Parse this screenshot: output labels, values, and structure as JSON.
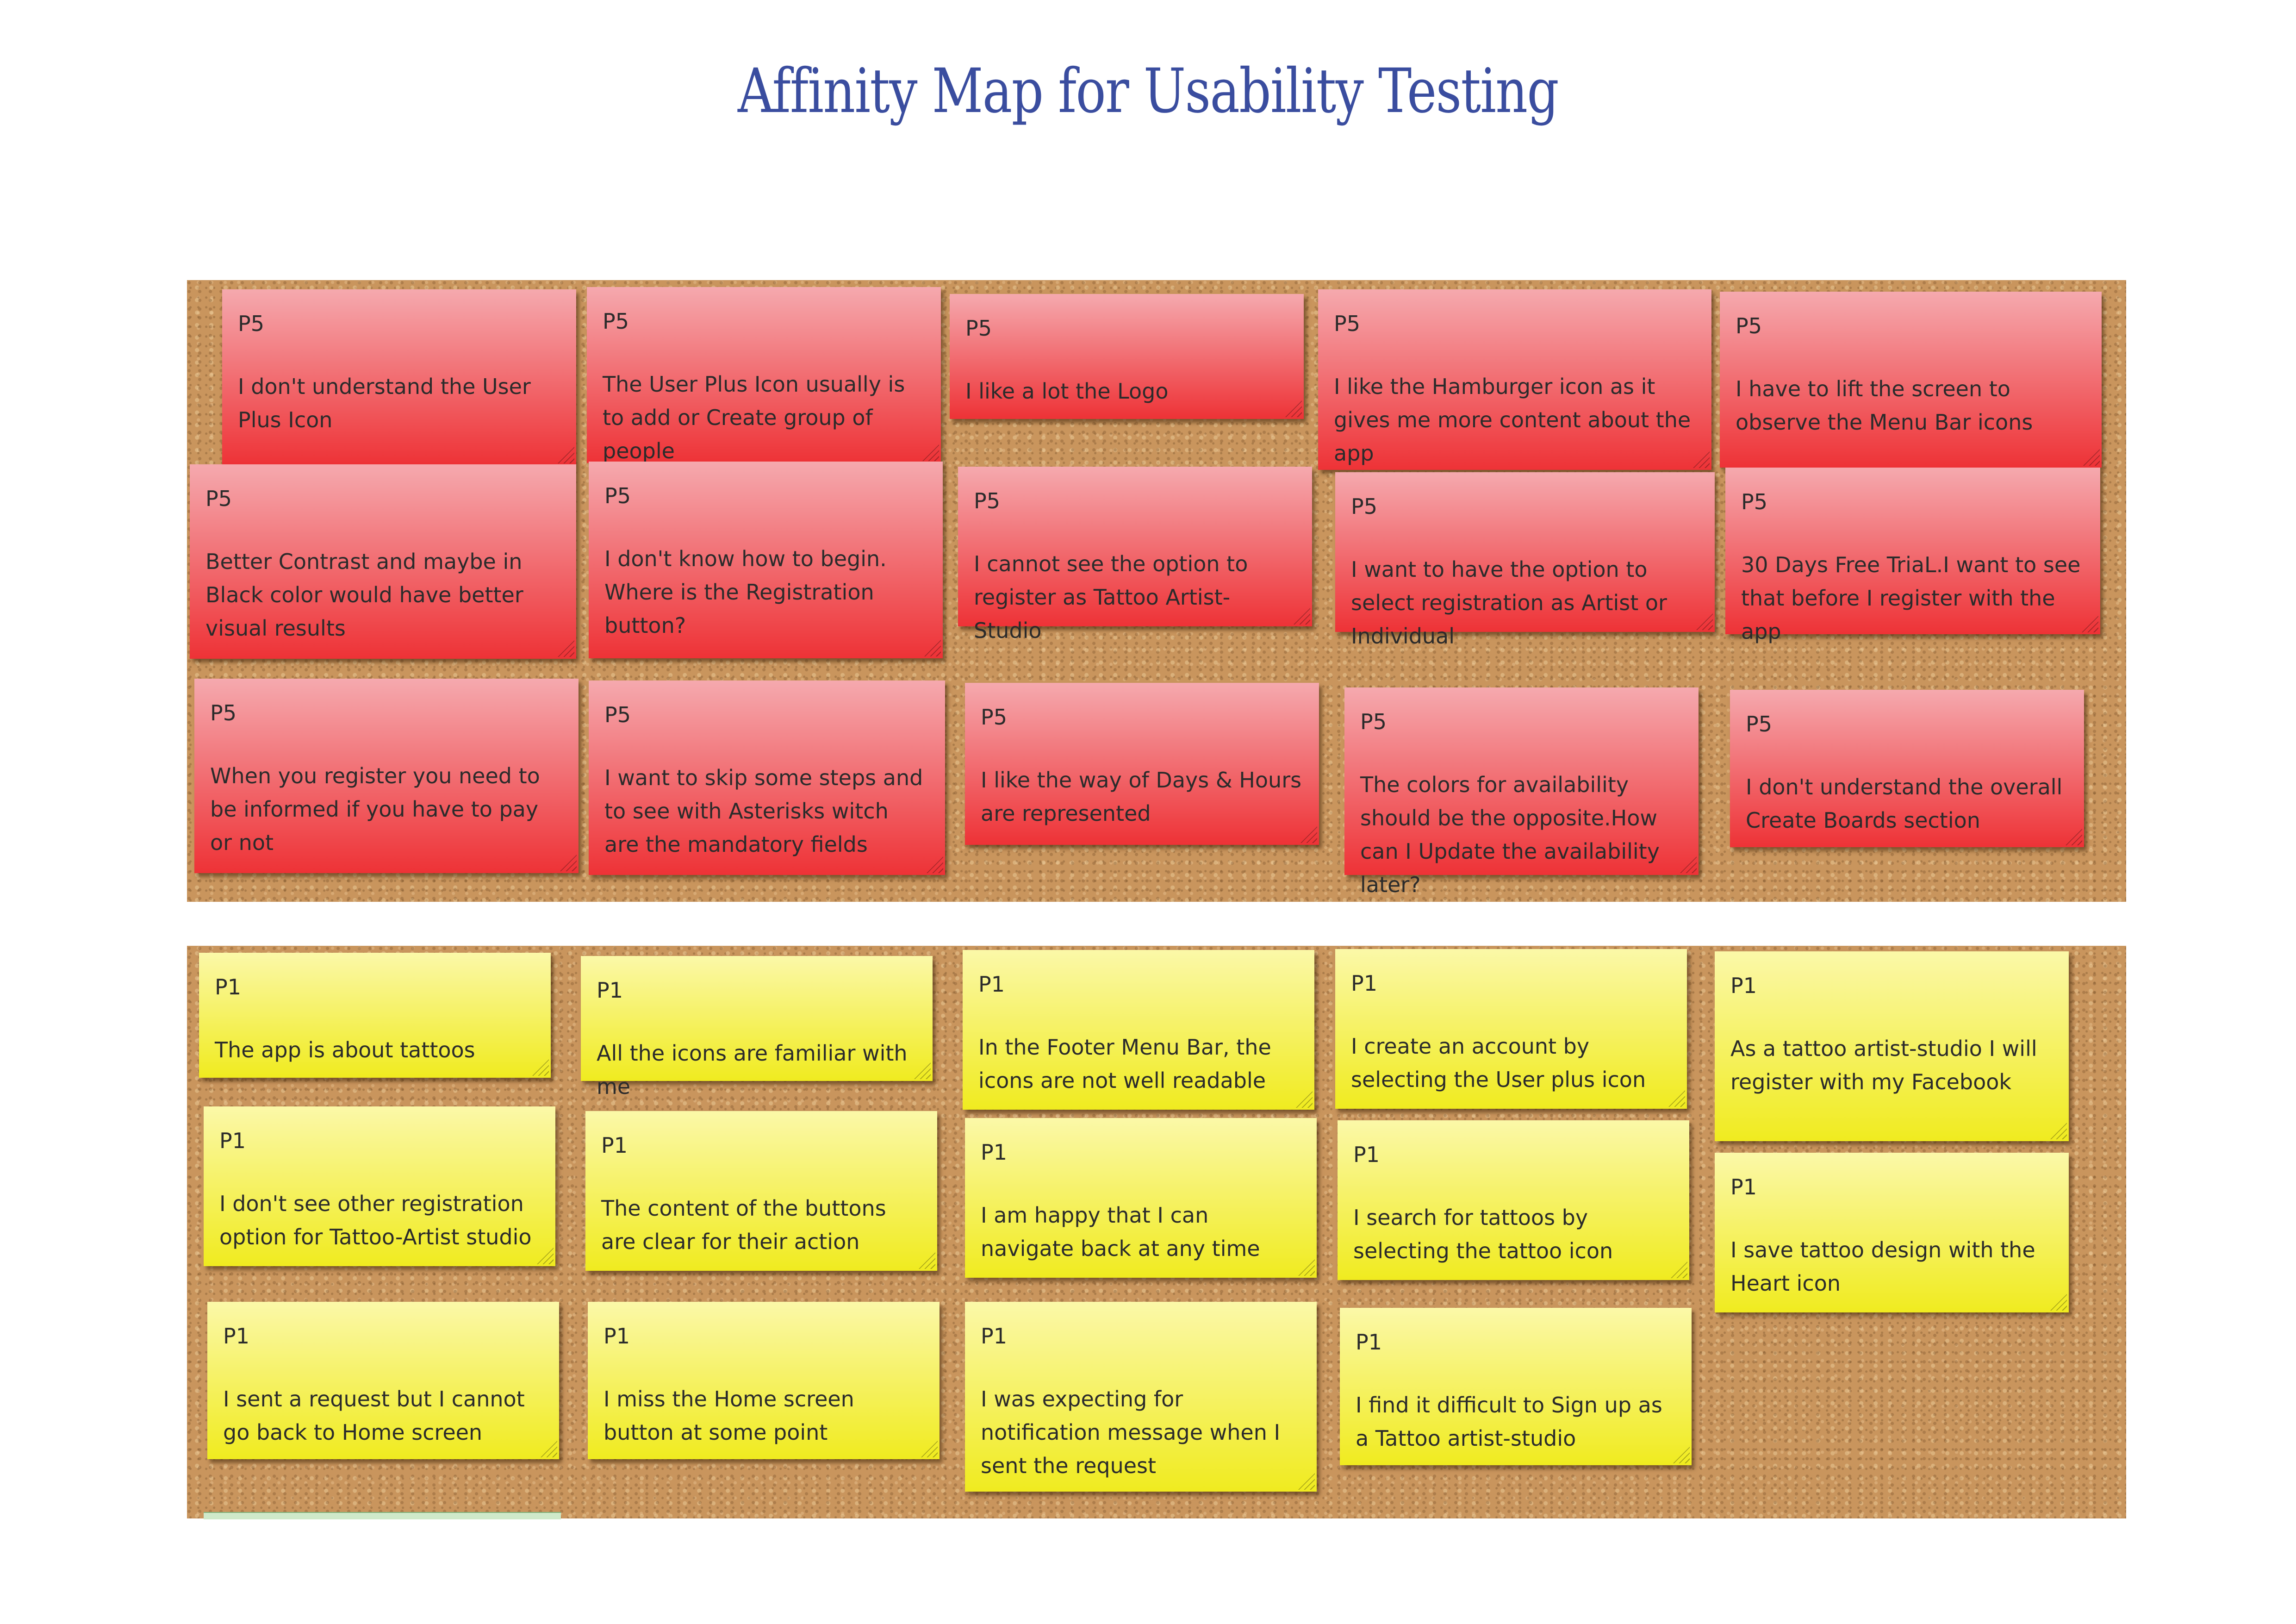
{
  "title": "Affinity Map for Usability Testing",
  "colors": {
    "title": "#3a4d9f",
    "red_note_top": "#f5a9ae",
    "red_note_bottom": "#ee3236",
    "yellow_note_top": "#fbf8a8",
    "yellow_note_bottom": "#f0eb1f",
    "cork": "#c9955d"
  },
  "boards": [
    {
      "participant": "P5",
      "color": "red",
      "notes": [
        {
          "pid": "P5",
          "text": "I don't understand the User Plus Icon"
        },
        {
          "pid": "P5",
          "text": "The User Plus Icon usually is to add or Create group of people"
        },
        {
          "pid": "P5",
          "text": "I like a lot the Logo"
        },
        {
          "pid": "P5",
          "text": "I like the Hamburger icon as it gives me more content about the app"
        },
        {
          "pid": "P5",
          "text": "I have to lift the screen to observe the Menu Bar icons"
        },
        {
          "pid": "P5",
          "text": "Better Contrast and maybe in Black color would have better visual results"
        },
        {
          "pid": "P5",
          "text": "I don't know how to begin. Where is the Registration button?"
        },
        {
          "pid": "P5",
          "text": "I cannot see the option to register as Tattoo Artist-Studio"
        },
        {
          "pid": "P5",
          "text": "I want to have the option to select registration as Artist or Individual"
        },
        {
          "pid": "P5",
          "text": "30 Days Free TriaL.I want to see that before I register with the app"
        },
        {
          "pid": "P5",
          "text": "When you register you need to be informed if you have to pay or not"
        },
        {
          "pid": "P5",
          "text": "I want to skip some steps and to see with Asterisks witch are the mandatory fields"
        },
        {
          "pid": "P5",
          "text": "I like the way of Days & Hours are represented"
        },
        {
          "pid": "P5",
          "text": "The colors for availability should be the opposite.How can I Update the availability later?"
        },
        {
          "pid": "P5",
          "text": "I don't understand the overall Create Boards section"
        }
      ]
    },
    {
      "participant": "P1",
      "color": "yellow",
      "notes": [
        {
          "pid": "P1",
          "text": "The app is about tattoos"
        },
        {
          "pid": "P1",
          "text": "All the icons are familiar with me"
        },
        {
          "pid": "P1",
          "text": "In the Footer Menu Bar, the icons are not well readable"
        },
        {
          "pid": "P1",
          "text": "I create an account by selecting the User plus icon"
        },
        {
          "pid": "P1",
          "text": "As a tattoo artist-studio I will register with my Facebook"
        },
        {
          "pid": "P1",
          "text": "I don't see other registration option for Tattoo-Artist studio"
        },
        {
          "pid": "P1",
          "text": "The content of the buttons are clear for their action"
        },
        {
          "pid": "P1",
          "text": "I am happy that I can navigate back at any time"
        },
        {
          "pid": "P1",
          "text": "I search for tattoos by selecting the tattoo icon"
        },
        {
          "pid": "P1",
          "text": "I save tattoo design with the Heart icon"
        },
        {
          "pid": "P1",
          "text": "I sent a request but I cannot go back to Home screen"
        },
        {
          "pid": "P1",
          "text": "I miss the Home screen button at some point"
        },
        {
          "pid": "P1",
          "text": "I was expecting for notification message when I sent the request"
        },
        {
          "pid": "P1",
          "text": "I find it difficult to Sign up as a Tattoo artist-studio"
        }
      ]
    }
  ]
}
